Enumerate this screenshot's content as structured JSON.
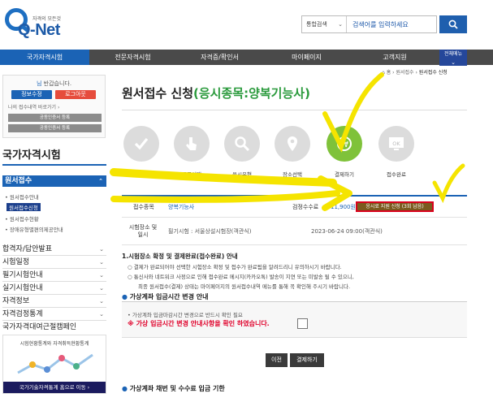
{
  "header": {
    "logo_sub": "자격의 모든것",
    "logo_text": "Q-Net",
    "search_category": "통합검색",
    "search_placeholder": "검색어를 입력하세요"
  },
  "gnb": {
    "items": [
      "국가자격시험",
      "전문자격시험",
      "자격증/확인서",
      "마이페이지",
      "고객지원"
    ],
    "all_menu": "전체메뉴"
  },
  "sidebar": {
    "greeting_name": "님",
    "greeting": "반갑습니다.",
    "info_button": "정보수정",
    "logout_button": "로그아웃",
    "my_link": "나의 접수내역 바로가기",
    "cert_button_1": "공동인증서 등록",
    "cert_button_2": "공동인증서 등록",
    "title": "국가자격시험",
    "section": "원서접수",
    "subs": [
      "원서접수안내",
      "원서접수신청",
      "원서접수현황",
      "장애유형별편의제공안내"
    ],
    "menus": [
      "합격자/답안발표",
      "시험일정",
      "필기시험안내",
      "실기시험안내",
      "자격정보",
      "자격검정통계",
      "국가자격대여근절캠페인"
    ],
    "banner_text": "시험현황통계와 자격취득현황통계",
    "banner_bar": "국가기술자격통계 홈으로 이동"
  },
  "main": {
    "breadcrumb": [
      "홈",
      "원서접수",
      "원서접수 신청"
    ],
    "title": "원서접수 신청",
    "title_sub": "(응시종목:양복기능사)",
    "steps": [
      "자격선택",
      "종목선택",
      "응시유형",
      "장소선택",
      "결제하기",
      "접수완료"
    ],
    "info": {
      "field_label": "접수종목",
      "field_value": "양복기능사",
      "fee_label": "검정수수료",
      "fee_value": "11,900원",
      "retry_button": "응시료 지원 신청 (3회 남음)",
      "place_label": "시험장소 및 일시",
      "place_value": "필기시험 : 서울상설시험장(객관식)",
      "date_value": "2023-06-24 09:00(객관식)"
    },
    "notice_title": "1.시험장소 확정 및 결제완료(접수완료) 안내",
    "notice_items": [
      "○ 결제가 완료되어야 선택한 시험장소 확정 및 접수가 완료됨을 알려드리니 유의하시기 바랍니다.",
      "○ 통신사와 네트워크 사정으로 인해 접수완료 메시지(카카오톡) 발송이 지연 또는 미발송 될 수 있으니,",
      "최종 원서접수(결제) 상태는 마이페이지의 원서접수내역 메뉴를 통해 꼭 확인해 주시기 바랍니다."
    ],
    "section1": "가상계좌 입금시간 변경 안내",
    "box_line1": "• 가상계좌 입금마감시간 변경으로 반드시 확인 필요",
    "box_line2": "※ 가상 입금시간 변경 안내사항을 확인 하였습니다.",
    "prev_button": "이전",
    "pay_button": "결제하기",
    "section2": "가상계좌 채번 및 수수료 입금 기한"
  }
}
